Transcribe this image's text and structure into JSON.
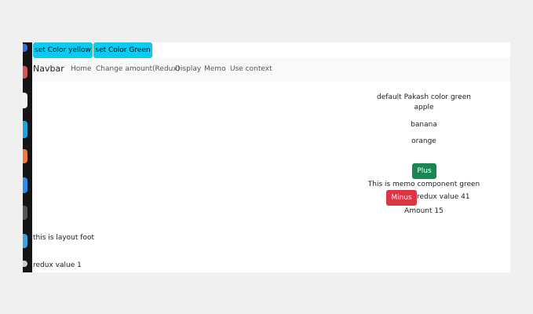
{
  "toolbar": {
    "yellow_label": "set Color yellow",
    "green_label": "set Color Green"
  },
  "navbar": {
    "brand": "Navbar",
    "links": [
      "Home",
      "Change amount(Redux)",
      "Display",
      "Memo",
      "Use context"
    ]
  },
  "content": {
    "default_color": "default Pakash color green",
    "fruits": [
      "apple",
      "banana",
      "orange"
    ],
    "plus_label": "Plus",
    "memo_text": "This is memo component green",
    "minus_label": "Minus",
    "redux_value_main": "redux value 41",
    "amount": "Amount 15"
  },
  "footer": {
    "layout_foot": "this is layout foot",
    "redux_value": "redux value 1"
  },
  "colors": {
    "info": "#0dcaf0",
    "success": "#198754",
    "danger": "#dc3545",
    "navbar_bg": "#f8f9fa"
  }
}
